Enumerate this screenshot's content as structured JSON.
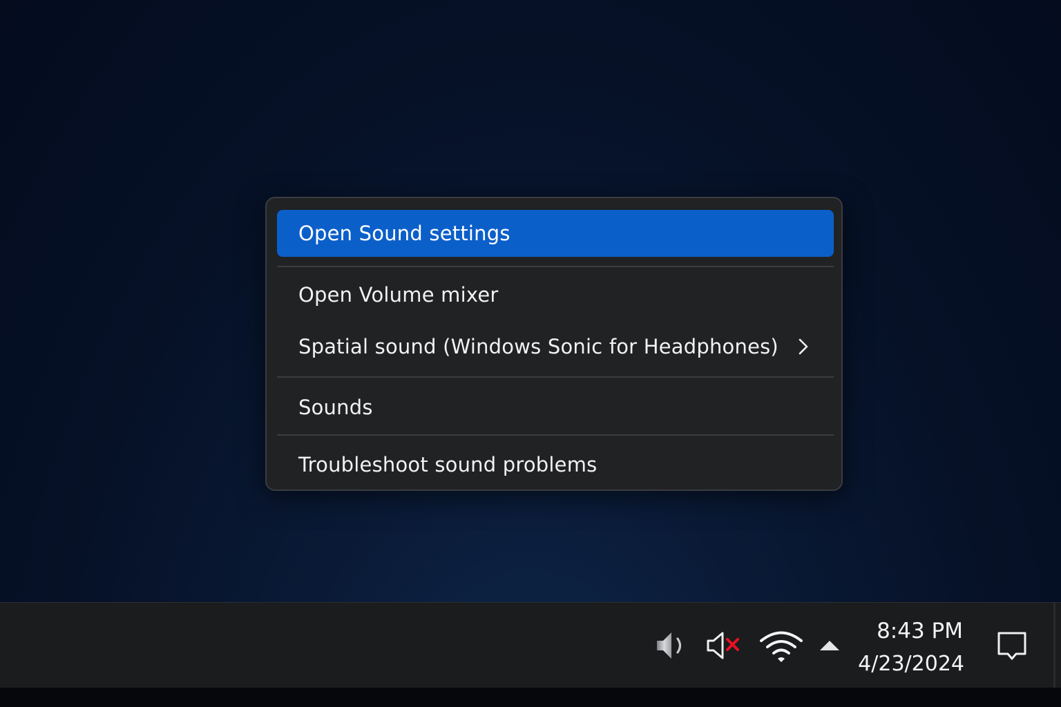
{
  "context_menu": {
    "items": [
      {
        "label": "Open Sound settings",
        "highlighted": true
      },
      {
        "label": "Open Volume mixer"
      },
      {
        "label": "Spatial sound (Windows Sonic for Headphones)",
        "has_submenu": true,
        "submenu_icon": "chevron-right-icon"
      },
      {
        "label": "Sounds"
      },
      {
        "label": "Troubleshoot sound problems"
      }
    ],
    "highlight_color": "#0b5fc9"
  },
  "taskbar": {
    "tray_icons": [
      {
        "name": "speaker-volume-icon"
      },
      {
        "name": "speaker-muted-icon",
        "accent_color": "#e81123"
      },
      {
        "name": "wifi-icon"
      },
      {
        "name": "show-hidden-icons-icon"
      },
      {
        "name": "notification-center-icon"
      }
    ],
    "clock": {
      "time": "8:43 PM",
      "date": "4/23/2024"
    }
  }
}
